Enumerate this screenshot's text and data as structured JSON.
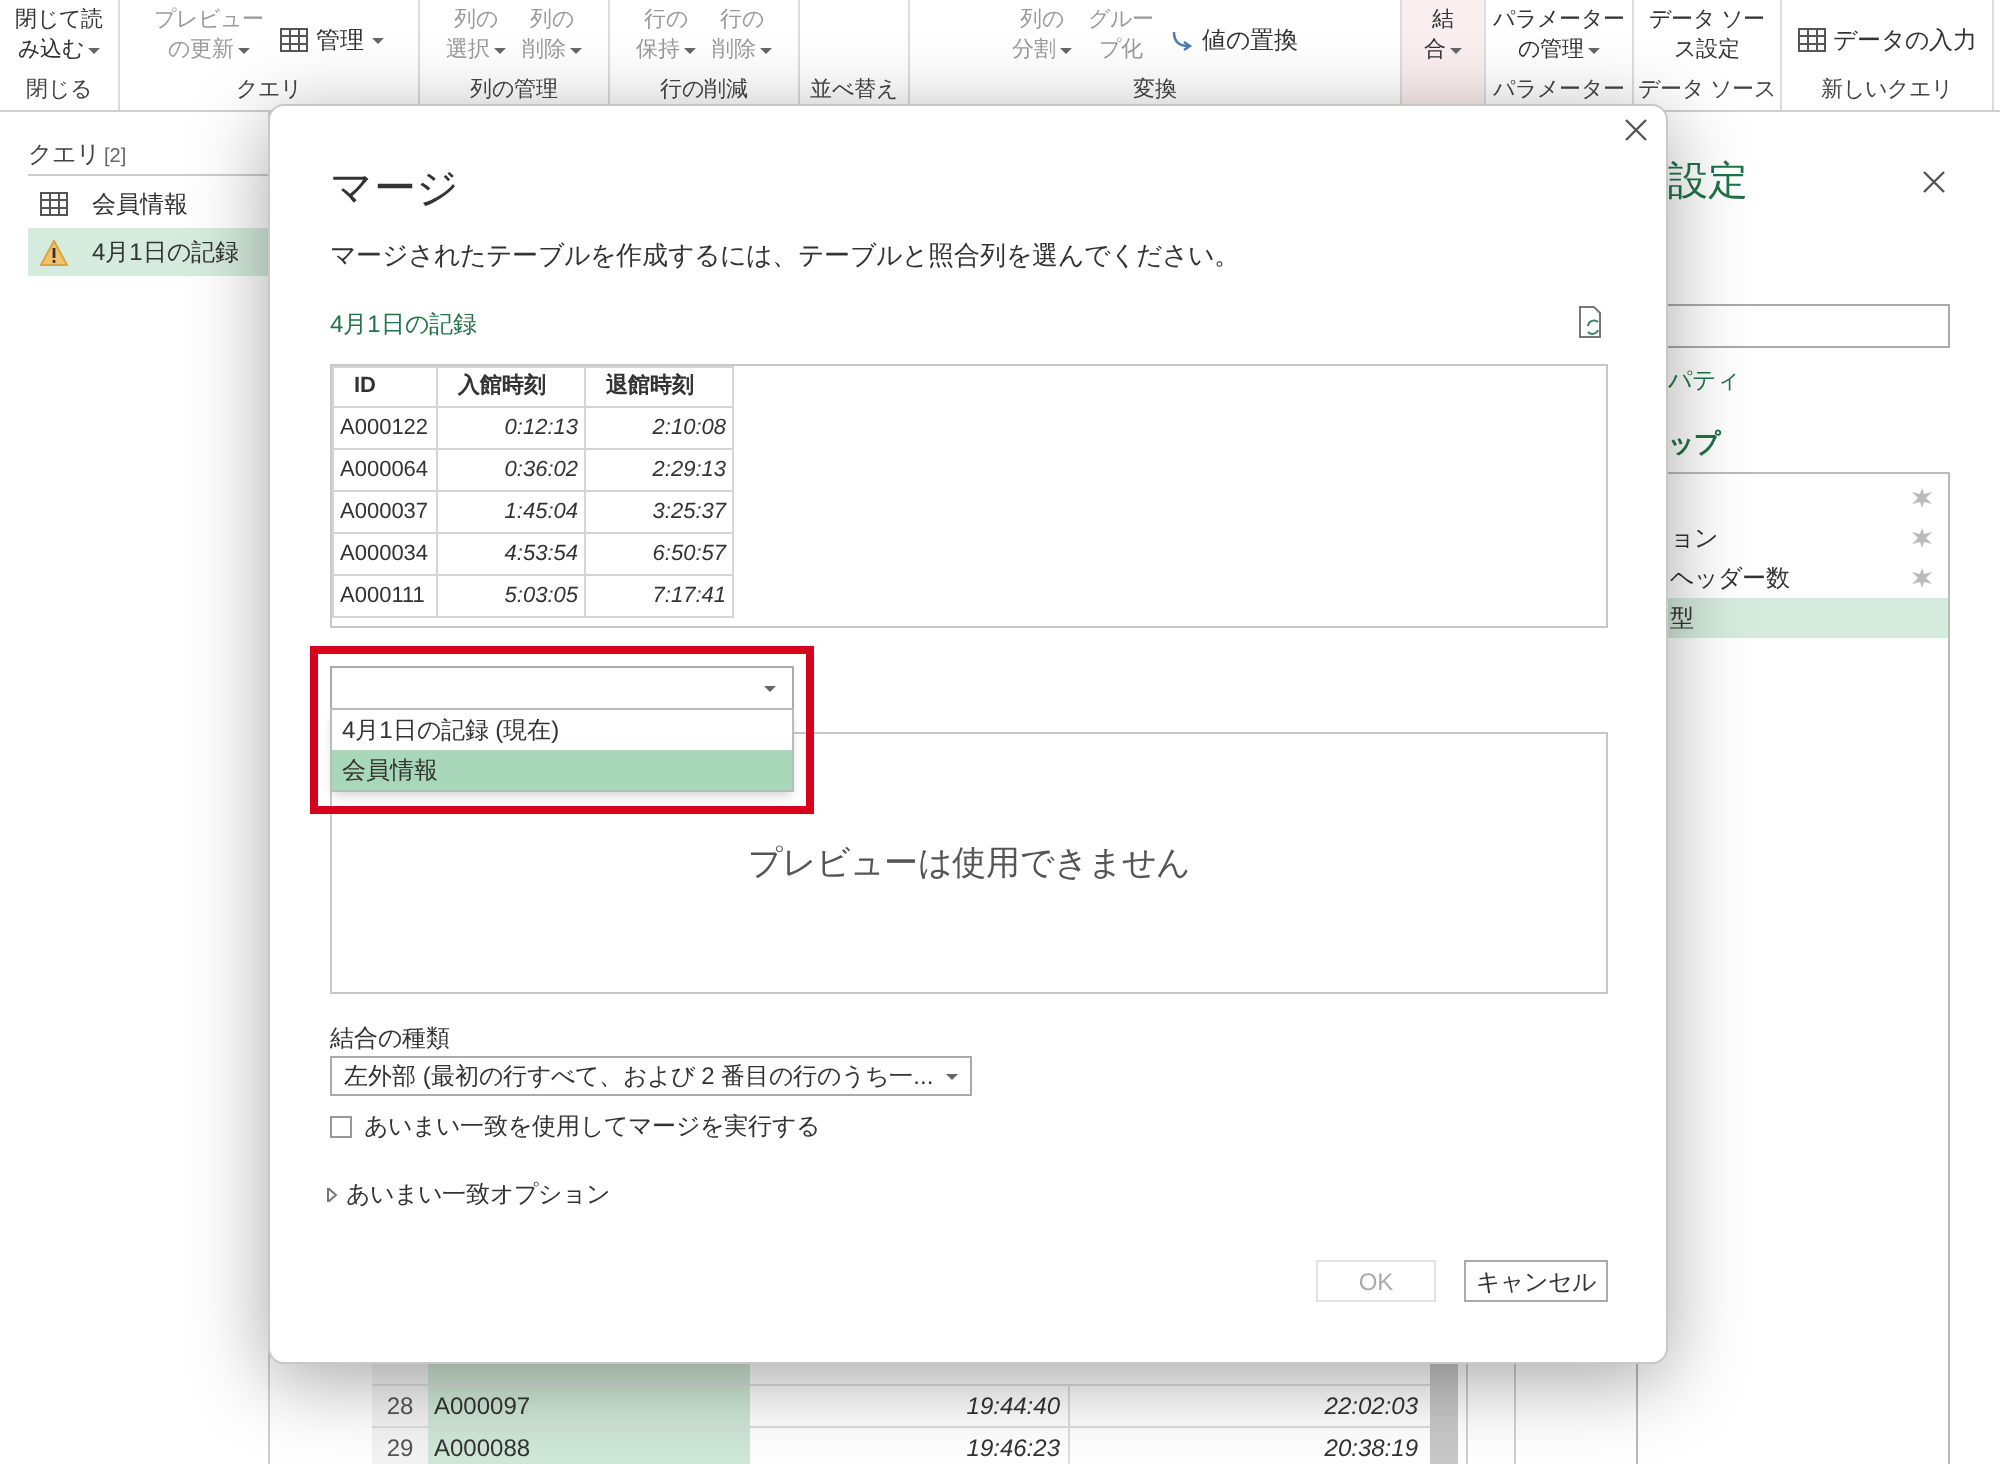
{
  "ribbon": {
    "groups": [
      {
        "label": "閉じる",
        "items": [
          {
            "kind": "large",
            "lines": [
              "閉じて読",
              "み込む"
            ],
            "menu": true,
            "disabled": false
          }
        ]
      },
      {
        "label": "クエリ",
        "items": [
          {
            "kind": "large",
            "lines": [
              "プレビュー",
              "の更新"
            ],
            "menu": true,
            "disabled": true
          },
          {
            "kind": "small",
            "label": "管理",
            "menu": true,
            "disabled": false
          }
        ]
      },
      {
        "label": "列の管理",
        "items": [
          {
            "kind": "large",
            "lines": [
              "列の",
              "選択"
            ],
            "menu": true,
            "disabled": true
          },
          {
            "kind": "large",
            "lines": [
              "列の",
              "削除"
            ],
            "menu": true,
            "disabled": true
          }
        ]
      },
      {
        "label": "行の削減",
        "items": [
          {
            "kind": "large",
            "lines": [
              "行の",
              "保持"
            ],
            "menu": true,
            "disabled": true
          },
          {
            "kind": "large",
            "lines": [
              "行の",
              "削除"
            ],
            "menu": true,
            "disabled": true
          }
        ]
      },
      {
        "label": "並べ替え"
      },
      {
        "label": "変換",
        "items": [
          {
            "kind": "large",
            "lines": [
              "列の",
              "分割"
            ],
            "menu": true,
            "disabled": true
          },
          {
            "kind": "large",
            "lines": [
              "グルー",
              "プ化"
            ],
            "menu": false,
            "disabled": true
          },
          {
            "kind": "small",
            "label": "値の置換",
            "menu": false,
            "disabled": false
          }
        ]
      },
      {
        "highlighted": true,
        "items": [
          {
            "kind": "large",
            "lines": [
              "結",
              "合"
            ],
            "menu": true,
            "disabled": false
          }
        ]
      },
      {
        "label": "パラメーター",
        "items": [
          {
            "kind": "large",
            "lines": [
              "パラメーター",
              "の管理"
            ],
            "menu": true,
            "disabled": false
          }
        ]
      },
      {
        "label": "データ ソース",
        "items": [
          {
            "kind": "large",
            "lines": [
              "データ ソー",
              "ス設定"
            ],
            "menu": false,
            "disabled": false
          }
        ]
      },
      {
        "label": "新しいクエリ",
        "items": [
          {
            "kind": "small",
            "label": "データの入力",
            "menu": false,
            "disabled": false
          }
        ]
      }
    ]
  },
  "queries": {
    "title": "クエリ",
    "count": "[2]",
    "items": [
      {
        "name": "会員情報",
        "kind": "table",
        "selected": false
      },
      {
        "name": "4月1日の記録",
        "kind": "warning",
        "selected": true
      }
    ]
  },
  "grid": {
    "rows": [
      {
        "number": "28",
        "id": "A000097",
        "entry": "19:44:40",
        "exit": "22:02:03"
      },
      {
        "number": "29",
        "id": "A000088",
        "entry": "19:46:23",
        "exit": "20:38:19"
      }
    ]
  },
  "settings_panel": {
    "title": "設定",
    "properties_link": "パティ",
    "steps_heading": "ップ",
    "steps": [
      {
        "settings": true,
        "selected": false
      },
      {
        "label": "ョン",
        "settings": true,
        "selected": false
      },
      {
        "label": "ヘッダー数",
        "settings": true,
        "selected": false
      },
      {
        "label": "型",
        "settings": false,
        "selected": true
      }
    ]
  },
  "dialog": {
    "title": "マージ",
    "description": "マージされたテーブルを作成するには、テーブルと照合列を選んでください。",
    "first_table": {
      "label": "4月1日の記録",
      "columns": [
        "ID",
        "入館時刻",
        "退館時刻"
      ],
      "rows": [
        [
          "A000122",
          "0:12:13",
          "2:10:08"
        ],
        [
          "A000064",
          "0:36:02",
          "2:29:13"
        ],
        [
          "A000037",
          "1:45:04",
          "3:25:37"
        ],
        [
          "A000034",
          "4:53:54",
          "6:50:57"
        ],
        [
          "A000111",
          "5:03:05",
          "7:17:41"
        ]
      ]
    },
    "table_select": {
      "highlighted": true,
      "options": [
        {
          "label": "4月1日の記録 (現在)",
          "selected": false
        },
        {
          "label": "会員情報",
          "selected": true
        }
      ]
    },
    "preview_message": "プレビューは使用できません",
    "join_kind": {
      "label": "結合の種類",
      "value": "左外部 (最初の行すべて、および 2 番目の行のうち一..."
    },
    "fuzzy": {
      "label": "あいまい一致を使用してマージを実行する",
      "checked": false
    },
    "fuzzy_options": {
      "label": "あいまい一致オプション",
      "expanded": false
    },
    "buttons": [
      {
        "label": "OK",
        "disabled": true
      },
      {
        "label": "キャンセル",
        "disabled": false
      }
    ]
  }
}
